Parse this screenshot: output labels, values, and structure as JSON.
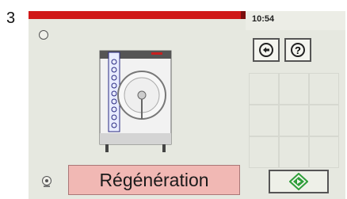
{
  "step_number": "3",
  "status": {
    "time": "10:54"
  },
  "nav": {
    "back_icon": "circle-arrow-left-icon",
    "help_icon": "circle-question-icon",
    "help_glyph": "?"
  },
  "main": {
    "action_label": "Régénération"
  },
  "footer": {
    "start_icon": "green-diamond-start-icon"
  },
  "colors": {
    "accent_red": "#d01818",
    "button_pink": "#f1b8b4",
    "start_green": "#2e9e3a",
    "panel_bg": "#e6e8e0"
  }
}
